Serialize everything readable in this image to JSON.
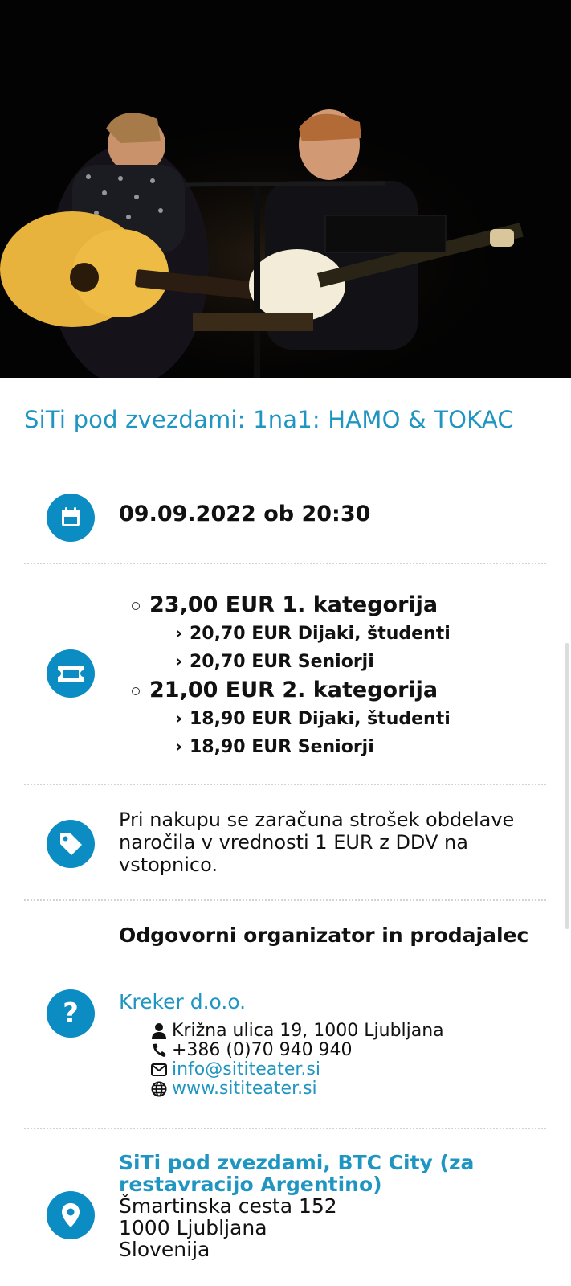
{
  "event": {
    "title": "SiTi pod zvezdami: 1na1: HAMO & TOKAC",
    "datetime": "09.09.2022 ob 20:30"
  },
  "prices": [
    {
      "label": "23,00 EUR 1. kategorija",
      "sub": [
        "20,70 EUR Dijaki, študenti",
        "20,70 EUR Seniorji"
      ]
    },
    {
      "label": "21,00 EUR 2. kategorija",
      "sub": [
        "18,90 EUR Dijaki, študenti",
        "18,90 EUR Seniorji"
      ]
    }
  ],
  "fee_note": "Pri nakupu se zaračuna strošek obdelave naročila v vrednosti 1 EUR z DDV na vstopnico.",
  "organizer": {
    "heading": "Odgovorni organizator in prodajalec",
    "name": "Kreker d.o.o.",
    "address": "Križna ulica 19, 1000 Ljubljana",
    "phone": "+386 (0)70 940 940",
    "email": "info@sititeater.si",
    "web": "www.sititeater.si"
  },
  "venue": {
    "name": "SiTi pod zvezdami, BTC City (za restavracijo Argentino)",
    "street": "Šmartinska cesta 152",
    "city": "1000 Ljubljana",
    "country": "Slovenija"
  },
  "icons": {
    "date": "calendar-icon",
    "price": "ticket-icon",
    "fee": "tag-icon",
    "organizer": "question-icon",
    "venue": "map-pin-icon"
  },
  "colors": {
    "accent": "#0b8cc3",
    "link": "#1f95c1"
  }
}
